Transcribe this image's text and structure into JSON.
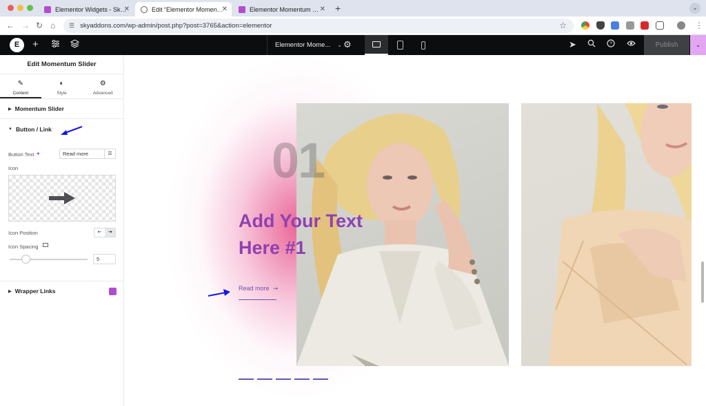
{
  "browser": {
    "tabs": [
      {
        "title": "Elementor Widgets - Sky Addons",
        "favicon": "sky-addons-icon",
        "active": false
      },
      {
        "title": "Edit “Elementor Momentum Slider”",
        "favicon": "globe-icon",
        "active": true
      },
      {
        "title": "Elementor Momentum Slider",
        "favicon": "sky-addons-icon",
        "active": false
      }
    ],
    "url": "skyaddons.com/wp-admin/post.php?post=3765&action=elementor",
    "close_glyph": "✕",
    "newtab_glyph": "+"
  },
  "elementor_bar": {
    "logo_text": "E",
    "document_title": "Elementor Mome...",
    "publish_label": "Publish",
    "colors": {
      "bar_bg": "#0c0d0e",
      "publish_more_bg": "#e3a6f3"
    }
  },
  "panel": {
    "title": "Edit Momentum Slider",
    "tabs": [
      {
        "label": "Content",
        "icon": "pencil-icon",
        "active": true
      },
      {
        "label": "Style",
        "icon": "half-circle-icon",
        "active": false
      },
      {
        "label": "Advanced",
        "icon": "gear-icon",
        "active": false
      }
    ],
    "sections": {
      "momentum_slider": "Momentum Slider",
      "button_link": "Button / Link",
      "wrapper_links": "Wrapper Links"
    },
    "controls": {
      "button_text_label": "Button Text",
      "button_text_value": "Read more",
      "icon_label": "Icon",
      "icon_position_label": "Icon Position",
      "icon_spacing_label": "Icon Spacing",
      "icon_spacing_value": "5",
      "icon_spacing_level": 0.2
    }
  },
  "canvas": {
    "slide_number": "01",
    "slide_title_line1": "Add Your Text",
    "slide_title_line2": "Here #1",
    "read_more": "Read more",
    "read_more_arrow": "➞",
    "pagination_count": 5,
    "colors": {
      "accent": "#9040b0",
      "link": "#6c53ad",
      "annotation_arrow": "#1515e0"
    }
  }
}
